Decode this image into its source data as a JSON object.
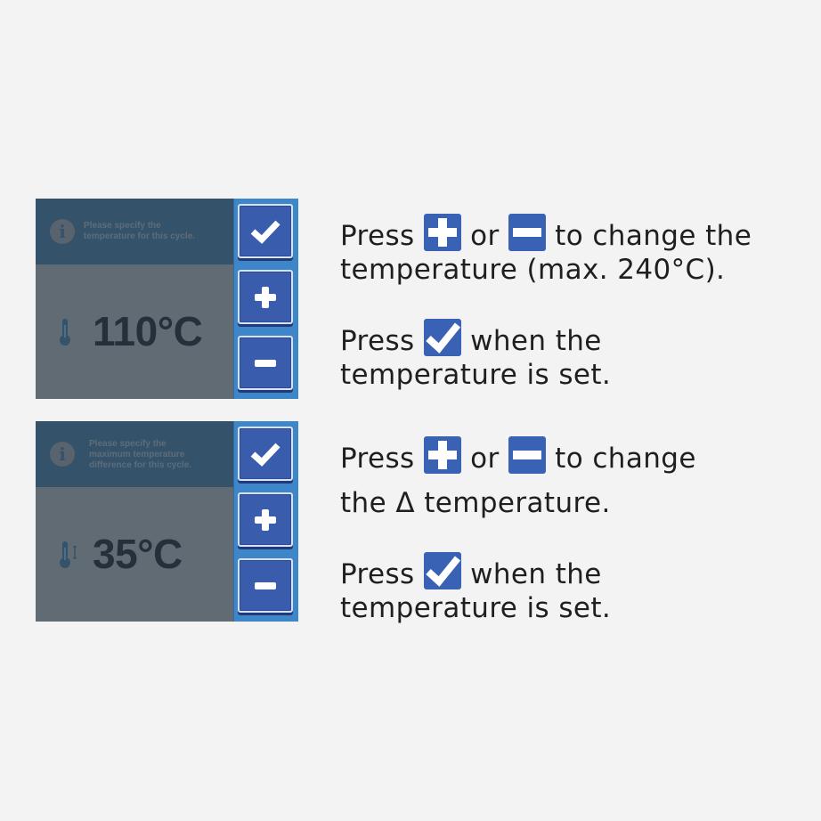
{
  "panels": [
    {
      "hint": "Please specify the\ntemperature for this cycle.",
      "value": "110°C",
      "thermometer": "thermometer-icon",
      "buttons": {
        "confirm": "check-icon",
        "increase": "plus-icon",
        "decrease": "minus-icon"
      }
    },
    {
      "hint": "Please specify the\nmaximum temperature\ndifference for this cycle.",
      "value": "35°C",
      "thermometer": "delta-thermometer-icon",
      "buttons": {
        "confirm": "check-icon",
        "increase": "plus-icon",
        "decrease": "minus-icon"
      }
    }
  ],
  "instructions": {
    "block1": {
      "press1": "Press",
      "or1": "or",
      "change1": "to change the",
      "line2": "temperature (max. 240°C).",
      "press2": "Press",
      "when1": "when the",
      "line4": "temperature is set."
    },
    "block2": {
      "press1": "Press",
      "or1": "or",
      "change1": "to change",
      "line2": "the Δ temperature.",
      "press2": "Press",
      "when1": "when the",
      "line4": "temperature is set."
    }
  },
  "colors": {
    "background": "#f3f3f3",
    "screen": "#616b74",
    "screen_header": "#34536b",
    "side_bar": "#3d86c9",
    "button": "#3a5cad",
    "inline_icon": "#3a62b4"
  }
}
